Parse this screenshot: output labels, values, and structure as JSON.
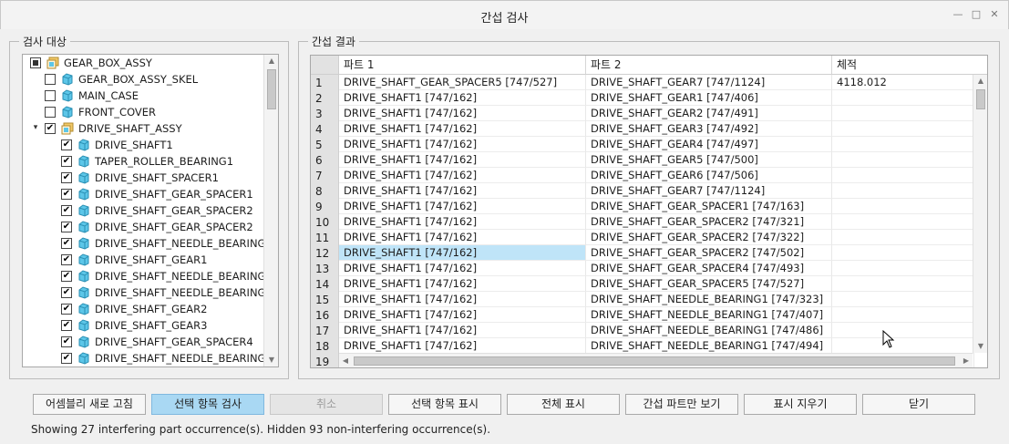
{
  "window": {
    "title": "간섭 검사"
  },
  "check_target": {
    "legend": "검사 대상",
    "tree": [
      {
        "label": "GEAR_BOX_ASSY",
        "level": 0,
        "check": "partial",
        "expander": "none",
        "icon": "assembly"
      },
      {
        "label": "GEAR_BOX_ASSY_SKEL",
        "level": 1,
        "check": "unchecked",
        "expander": "none",
        "icon": "part"
      },
      {
        "label": "MAIN_CASE",
        "level": 1,
        "check": "unchecked",
        "expander": "none",
        "icon": "part"
      },
      {
        "label": "FRONT_COVER",
        "level": 1,
        "check": "unchecked",
        "expander": "none",
        "icon": "part"
      },
      {
        "label": "DRIVE_SHAFT_ASSY",
        "level": 1,
        "check": "checked",
        "expander": "expanded",
        "icon": "assembly"
      },
      {
        "label": "DRIVE_SHAFT1",
        "level": 2,
        "check": "checked",
        "expander": "none",
        "icon": "part"
      },
      {
        "label": "TAPER_ROLLER_BEARING1",
        "level": 2,
        "check": "checked",
        "expander": "none",
        "icon": "part"
      },
      {
        "label": "DRIVE_SHAFT_SPACER1",
        "level": 2,
        "check": "checked",
        "expander": "none",
        "icon": "part"
      },
      {
        "label": "DRIVE_SHAFT_GEAR_SPACER1",
        "level": 2,
        "check": "checked",
        "expander": "none",
        "icon": "part"
      },
      {
        "label": "DRIVE_SHAFT_GEAR_SPACER2",
        "level": 2,
        "check": "checked",
        "expander": "none",
        "icon": "part"
      },
      {
        "label": "DRIVE_SHAFT_GEAR_SPACER2",
        "level": 2,
        "check": "checked",
        "expander": "none",
        "icon": "part"
      },
      {
        "label": "DRIVE_SHAFT_NEEDLE_BEARING1",
        "level": 2,
        "check": "checked",
        "expander": "none",
        "icon": "part"
      },
      {
        "label": "DRIVE_SHAFT_GEAR1",
        "level": 2,
        "check": "checked",
        "expander": "none",
        "icon": "part"
      },
      {
        "label": "DRIVE_SHAFT_NEEDLE_BEARING1",
        "level": 2,
        "check": "checked",
        "expander": "none",
        "icon": "part"
      },
      {
        "label": "DRIVE_SHAFT_NEEDLE_BEARING1",
        "level": 2,
        "check": "checked",
        "expander": "none",
        "icon": "part"
      },
      {
        "label": "DRIVE_SHAFT_GEAR2",
        "level": 2,
        "check": "checked",
        "expander": "none",
        "icon": "part"
      },
      {
        "label": "DRIVE_SHAFT_GEAR3",
        "level": 2,
        "check": "checked",
        "expander": "none",
        "icon": "part"
      },
      {
        "label": "DRIVE_SHAFT_GEAR_SPACER4",
        "level": 2,
        "check": "checked",
        "expander": "none",
        "icon": "part"
      },
      {
        "label": "DRIVE_SHAFT_NEEDLE_BEARING1",
        "level": 2,
        "check": "checked",
        "expander": "none",
        "icon": "part"
      }
    ]
  },
  "results": {
    "legend": "간섭 결과",
    "columns": [
      "파트 1",
      "파트 2",
      "체적"
    ],
    "selected_row": 12,
    "rows": [
      {
        "n": "1",
        "part1": "DRIVE_SHAFT_GEAR_SPACER5 [747/527]",
        "part2": "DRIVE_SHAFT_GEAR7 [747/1124]",
        "volume": "4118.012"
      },
      {
        "n": "2",
        "part1": "DRIVE_SHAFT1 [747/162]",
        "part2": "DRIVE_SHAFT_GEAR1 [747/406]",
        "volume": ""
      },
      {
        "n": "3",
        "part1": "DRIVE_SHAFT1 [747/162]",
        "part2": "DRIVE_SHAFT_GEAR2 [747/491]",
        "volume": ""
      },
      {
        "n": "4",
        "part1": "DRIVE_SHAFT1 [747/162]",
        "part2": "DRIVE_SHAFT_GEAR3 [747/492]",
        "volume": ""
      },
      {
        "n": "5",
        "part1": "DRIVE_SHAFT1 [747/162]",
        "part2": "DRIVE_SHAFT_GEAR4 [747/497]",
        "volume": ""
      },
      {
        "n": "6",
        "part1": "DRIVE_SHAFT1 [747/162]",
        "part2": "DRIVE_SHAFT_GEAR5 [747/500]",
        "volume": ""
      },
      {
        "n": "7",
        "part1": "DRIVE_SHAFT1 [747/162]",
        "part2": "DRIVE_SHAFT_GEAR6 [747/506]",
        "volume": ""
      },
      {
        "n": "8",
        "part1": "DRIVE_SHAFT1 [747/162]",
        "part2": "DRIVE_SHAFT_GEAR7 [747/1124]",
        "volume": ""
      },
      {
        "n": "9",
        "part1": "DRIVE_SHAFT1 [747/162]",
        "part2": "DRIVE_SHAFT_GEAR_SPACER1 [747/163]",
        "volume": ""
      },
      {
        "n": "10",
        "part1": "DRIVE_SHAFT1 [747/162]",
        "part2": "DRIVE_SHAFT_GEAR_SPACER2 [747/321]",
        "volume": ""
      },
      {
        "n": "11",
        "part1": "DRIVE_SHAFT1 [747/162]",
        "part2": "DRIVE_SHAFT_GEAR_SPACER2 [747/322]",
        "volume": ""
      },
      {
        "n": "12",
        "part1": "DRIVE_SHAFT1 [747/162]",
        "part2": "DRIVE_SHAFT_GEAR_SPACER2 [747/502]",
        "volume": ""
      },
      {
        "n": "13",
        "part1": "DRIVE_SHAFT1 [747/162]",
        "part2": "DRIVE_SHAFT_GEAR_SPACER4 [747/493]",
        "volume": ""
      },
      {
        "n": "14",
        "part1": "DRIVE_SHAFT1 [747/162]",
        "part2": "DRIVE_SHAFT_GEAR_SPACER5 [747/527]",
        "volume": ""
      },
      {
        "n": "15",
        "part1": "DRIVE_SHAFT1 [747/162]",
        "part2": "DRIVE_SHAFT_NEEDLE_BEARING1 [747/323]",
        "volume": ""
      },
      {
        "n": "16",
        "part1": "DRIVE_SHAFT1 [747/162]",
        "part2": "DRIVE_SHAFT_NEEDLE_BEARING1 [747/407]",
        "volume": ""
      },
      {
        "n": "17",
        "part1": "DRIVE_SHAFT1 [747/162]",
        "part2": "DRIVE_SHAFT_NEEDLE_BEARING1 [747/486]",
        "volume": ""
      },
      {
        "n": "18",
        "part1": "DRIVE_SHAFT1 [747/162]",
        "part2": "DRIVE_SHAFT_NEEDLE_BEARING1 [747/494]",
        "volume": ""
      },
      {
        "n": "19",
        "part1": "",
        "part2": "",
        "volume": ""
      }
    ]
  },
  "buttons": {
    "refresh_assembly": "어셈블리 새로 고침",
    "check_selected": "선택 항목 검사",
    "cancel": "취소",
    "show_selected": "선택 항목 표시",
    "show_all": "전체 표시",
    "show_interfering_only": "간섭 파트만 보기",
    "clear_display": "표시 지우기",
    "close": "닫기"
  },
  "status": "Showing 27 interfering part occurrence(s). Hidden 93 non-interfering occurrence(s).",
  "colors": {
    "selection": "#bfe4f8",
    "primary_button": "#a9d8f3",
    "part_icon": "#5cc6e8",
    "assembly_icon": "#f2c968"
  }
}
